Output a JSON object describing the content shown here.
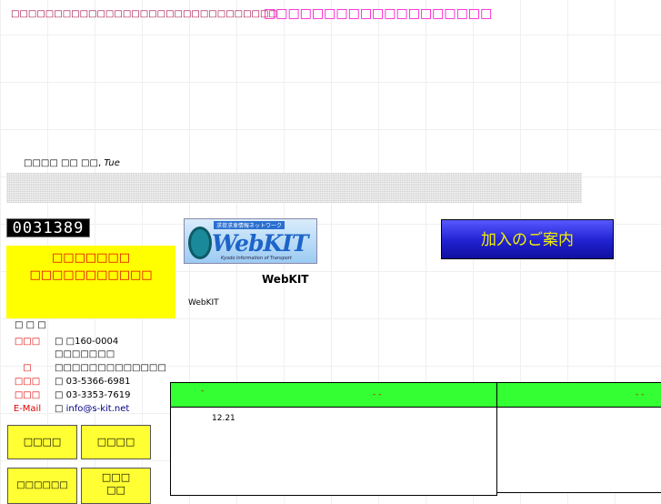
{
  "header": {
    "tagline": "□□□□□□□□□□□□□□□□□□□□□□□□□□□□□□□",
    "center_title": "□□□□□□□□□□□□□□□□□□□"
  },
  "date": {
    "text": "□□□□ □□ □□,",
    "weekday": "Tue"
  },
  "counter": {
    "value": "0031389"
  },
  "notice_box": {
    "line1": "□□□□□□□",
    "line2": "□□□□□□□□□□□"
  },
  "logo": {
    "jp_text": "求荷求車情報ネットワーク",
    "brand": "WebKIT",
    "subtitle": "Kyodo Information of Transport"
  },
  "main": {
    "title": "WebKIT",
    "description": "WebKIT"
  },
  "join_button": {
    "label": "加入のご案内"
  },
  "company": {
    "name": "□ □ □",
    "rows": [
      {
        "label": "□□□",
        "value": "□ □160-0004"
      },
      {
        "label": "",
        "value": "□□□□□□□"
      },
      {
        "label": "□",
        "value": "□□□□□□□□□□□□□"
      },
      {
        "label": "□□□",
        "value": "□ 03-5366-6981"
      },
      {
        "label": "□□□",
        "value": "□ 03-3353-7619"
      },
      {
        "label": "E-Mail",
        "value": "□ ",
        "link": "info@s-kit.net"
      }
    ]
  },
  "buttons": [
    {
      "label": "□□□□"
    },
    {
      "label": "□□□□"
    },
    {
      "label": "□□□□□□"
    },
    {
      "label": "□□□\n□□"
    }
  ],
  "panels": [
    {
      "header_a": "-",
      "header_b": "-   -",
      "news_date": "12.21"
    },
    {
      "header_a": "-  -"
    }
  ],
  "colors": {
    "accent_green": "#33ff33",
    "notice_yellow": "#ffff00",
    "label_red": "#e00000",
    "join_blue": "#2020d0"
  }
}
